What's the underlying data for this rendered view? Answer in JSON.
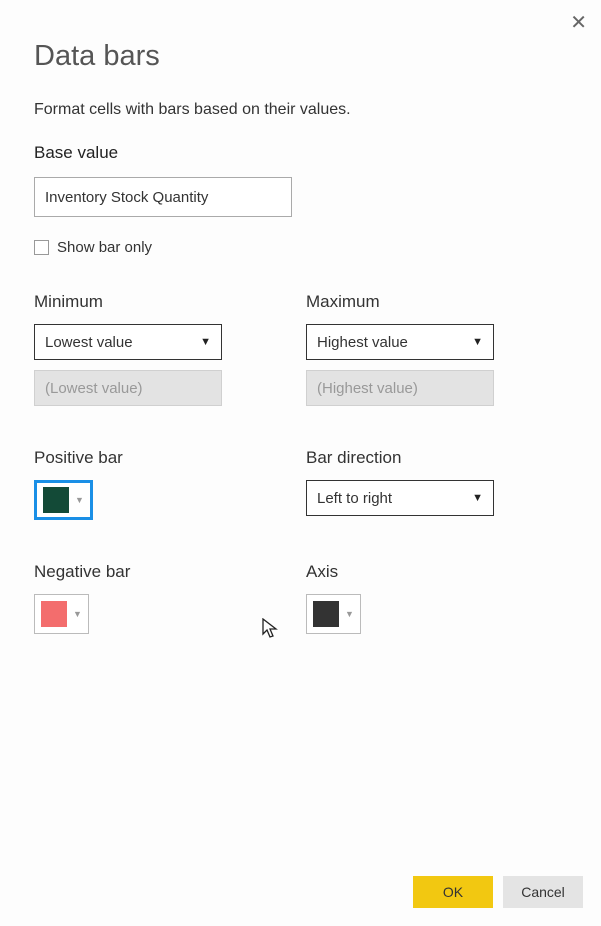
{
  "title": "Data bars",
  "subtitle": "Format cells with bars based on their values.",
  "baseValue": {
    "label": "Base value",
    "value": "Inventory Stock Quantity"
  },
  "showBarOnly": {
    "label": "Show bar only",
    "checked": false
  },
  "minimum": {
    "label": "Minimum",
    "select": "Lowest value",
    "placeholder": "(Lowest value)"
  },
  "maximum": {
    "label": "Maximum",
    "select": "Highest value",
    "placeholder": "(Highest value)"
  },
  "positiveBar": {
    "label": "Positive bar",
    "color": "#134a37"
  },
  "barDirection": {
    "label": "Bar direction",
    "select": "Left to right"
  },
  "negativeBar": {
    "label": "Negative bar",
    "color": "#f36d6d"
  },
  "axis": {
    "label": "Axis",
    "color": "#333333"
  },
  "buttons": {
    "ok": "OK",
    "cancel": "Cancel"
  }
}
